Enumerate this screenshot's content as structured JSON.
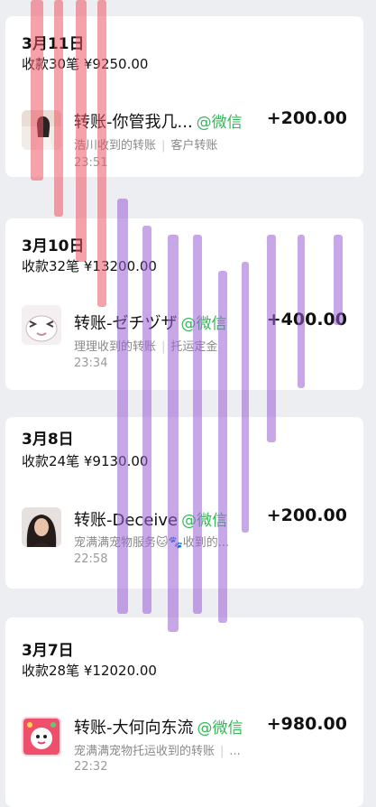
{
  "groups": [
    {
      "date": "3月11日",
      "summary": "收款30笔 ¥9250.00",
      "tx": {
        "title": "转账-你管我几...",
        "source": "@微信",
        "amount": "+200.00",
        "desc_left": "浩川收到的转账",
        "desc_right": "客户转账",
        "time": "23:51",
        "avatar": "woman-photo-avatar"
      }
    },
    {
      "date": "3月10日",
      "summary": "收款32笔 ¥13200.00",
      "tx": {
        "title": "转账-ゼチヅザ",
        "source": "@微信",
        "amount": "+400.00",
        "desc_left": "理理收到的转账",
        "desc_right": "托运定金",
        "time": "23:34",
        "avatar": "cartoon-face-avatar"
      }
    },
    {
      "date": "3月8日",
      "summary": "收款24笔 ¥9130.00",
      "tx": {
        "title": "转账-Deceive",
        "source": "@微信",
        "amount": "+200.00",
        "desc_left": "宠满满宠物服务🐱🐾收到的...",
        "desc_right": "",
        "time": "22:58",
        "avatar": "dark-hair-portrait-avatar"
      }
    },
    {
      "date": "3月7日",
      "summary": "收款28笔 ¥12020.00",
      "tx": {
        "title": "转账-大何向东流",
        "source": "@微信",
        "amount": "+980.00",
        "desc_left": "宠满满宠物托运收到的转账",
        "desc_right": "...",
        "time": "22:32",
        "avatar": "red-cartoon-avatar"
      }
    }
  ],
  "colors": {
    "background": "#eceef2",
    "card": "#ffffff",
    "wechat_green": "#35b85a",
    "overlay_red": "#ee5566",
    "overlay_purple": "#9a5fd6"
  }
}
